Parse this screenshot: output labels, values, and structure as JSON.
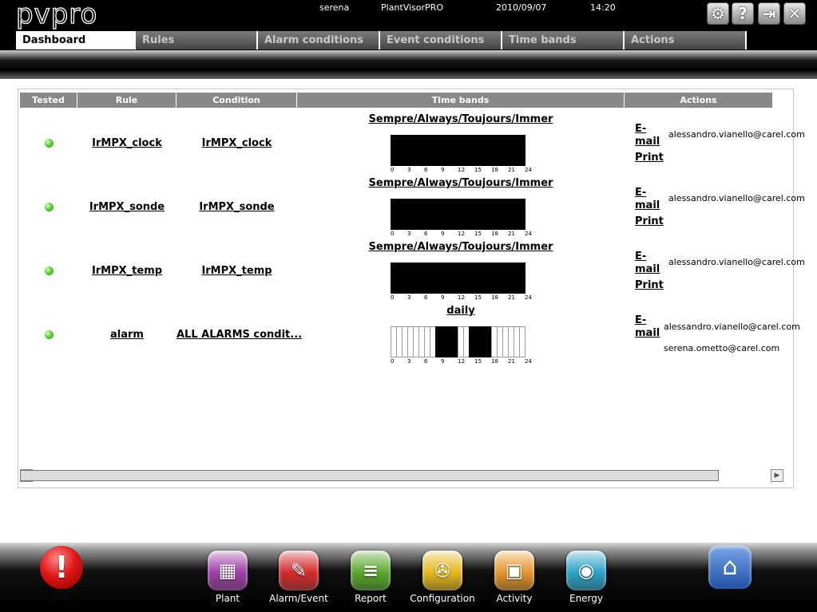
{
  "app": {
    "logo": "pvpro",
    "user": "serena",
    "product": "PlantVisorPRO",
    "date": "2010/09/07",
    "time": "14:20"
  },
  "toolbar_icons": [
    "tools-icon",
    "help-icon",
    "logout-icon",
    "close-icon"
  ],
  "tabs": [
    {
      "label": "Dashboard",
      "active": true
    },
    {
      "label": "Rules",
      "active": false
    },
    {
      "label": "Alarm conditions",
      "active": false
    },
    {
      "label": "Event conditions",
      "active": false
    },
    {
      "label": "Time bands",
      "active": false
    },
    {
      "label": "Actions",
      "active": false
    }
  ],
  "table": {
    "headers": [
      "Tested",
      "Rule",
      "Condition",
      "Time bands",
      "Actions"
    ],
    "tick_labels": [
      "0",
      "3",
      "6",
      "9",
      "12",
      "15",
      "18",
      "21",
      "24"
    ],
    "rows": [
      {
        "tested": "ok",
        "rule": "IrMPX_clock",
        "condition": "IrMPX_clock",
        "band_name": "Sempre/Always/Toujours/Immer",
        "band_on": [
          1,
          1,
          1,
          1,
          1,
          1,
          1,
          1,
          1,
          1,
          1,
          1,
          1,
          1,
          1,
          1,
          1,
          1,
          1,
          1,
          1,
          1,
          1,
          1
        ],
        "actions": [
          {
            "type": "E-mail",
            "detail": "alessandro.vianello@carel.com"
          },
          {
            "type": "Print",
            "detail": ""
          }
        ]
      },
      {
        "tested": "ok",
        "rule": "IrMPX_sonde",
        "condition": "IrMPX_sonde",
        "band_name": "Sempre/Always/Toujours/Immer",
        "band_on": [
          1,
          1,
          1,
          1,
          1,
          1,
          1,
          1,
          1,
          1,
          1,
          1,
          1,
          1,
          1,
          1,
          1,
          1,
          1,
          1,
          1,
          1,
          1,
          1
        ],
        "actions": [
          {
            "type": "E-mail",
            "detail": "alessandro.vianello@carel.com"
          },
          {
            "type": "Print",
            "detail": ""
          }
        ]
      },
      {
        "tested": "ok",
        "rule": "IrMPX_temp",
        "condition": "IrMPX_temp",
        "band_name": "Sempre/Always/Toujours/Immer",
        "band_on": [
          1,
          1,
          1,
          1,
          1,
          1,
          1,
          1,
          1,
          1,
          1,
          1,
          1,
          1,
          1,
          1,
          1,
          1,
          1,
          1,
          1,
          1,
          1,
          1
        ],
        "actions": [
          {
            "type": "E-mail",
            "detail": "alessandro.vianello@carel.com"
          },
          {
            "type": "Print",
            "detail": ""
          }
        ]
      },
      {
        "tested": "ok",
        "rule": "alarm",
        "condition": "ALL ALARMS condit...",
        "band_name": "daily",
        "band_on": [
          0,
          0,
          0,
          0,
          0,
          0,
          0,
          0,
          1,
          1,
          1,
          1,
          0,
          0,
          1,
          1,
          1,
          1,
          0,
          0,
          0,
          0,
          0,
          0
        ],
        "actions": [
          {
            "type": "E-mail",
            "detail": "alessandro.vianello@carel.com"
          },
          {
            "type": "",
            "detail": "serena.ometto@carel.com"
          }
        ]
      }
    ]
  },
  "dock": {
    "alarm_icon": "alarm-icon",
    "home_icon": "home-icon",
    "items": [
      {
        "label": "Plant",
        "icon": "plant-icon",
        "color": "#9c3fa6"
      },
      {
        "label": "Alarm/Event",
        "icon": "alarm-event-icon",
        "color": "#d42a2a"
      },
      {
        "label": "Report",
        "icon": "report-icon",
        "color": "#58a82a"
      },
      {
        "label": "Configuration",
        "icon": "configuration-icon",
        "color": "#e6b81c"
      },
      {
        "label": "Activity",
        "icon": "activity-icon",
        "color": "#e8962a"
      },
      {
        "label": "Energy",
        "icon": "energy-icon",
        "color": "#2aa3c8"
      }
    ]
  }
}
